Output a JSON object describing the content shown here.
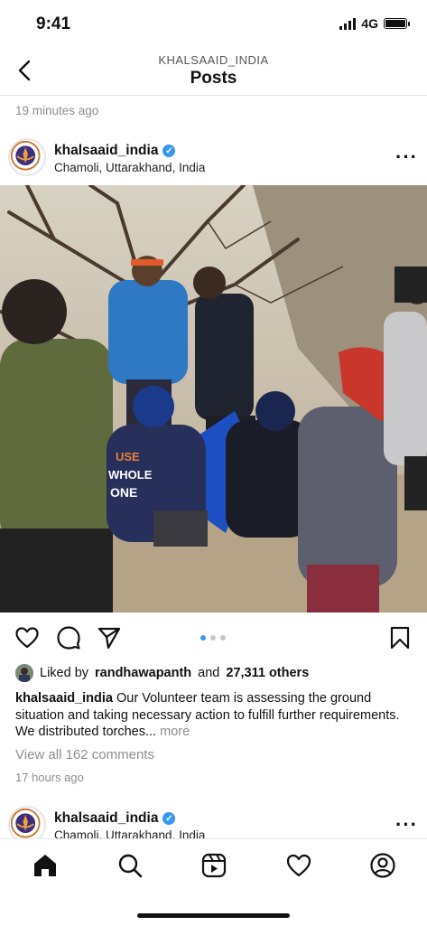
{
  "status_bar": {
    "time": "9:41",
    "network": "4G"
  },
  "header": {
    "account": "KHALSAAID_INDIA",
    "title": "Posts"
  },
  "previous_post_time": "19 minutes ago",
  "post": {
    "username": "khalsaaid_india",
    "location": "Chamoli, Uttarakhand, India",
    "liked_by_prefix": "Liked by",
    "liked_by_user": "randhawapanth",
    "liked_by_and": "and",
    "likes_others": "27,311 others",
    "caption_user": "khalsaaid_india",
    "caption_text": "Our Volunteer team is assessing the ground situation and taking necessary action to fulfill further requirements. We distributed torches...",
    "more_label": "more",
    "comments_label": "View all 162 comments",
    "time_ago": "17 hours ago",
    "carousel_index": 1,
    "carousel_total": 3
  },
  "next_post": {
    "username": "khalsaaid_india",
    "location": "Chamoli, Uttarakhand, India"
  },
  "tabs": [
    {
      "name": "home",
      "icon": "home-icon",
      "active": true
    },
    {
      "name": "search",
      "icon": "search-icon"
    },
    {
      "name": "reels",
      "icon": "reels-icon"
    },
    {
      "name": "activity",
      "icon": "heart-icon"
    },
    {
      "name": "profile",
      "icon": "profile-icon"
    }
  ],
  "colors": {
    "accent": "#3897f0",
    "muted": "#8e8e8e"
  }
}
